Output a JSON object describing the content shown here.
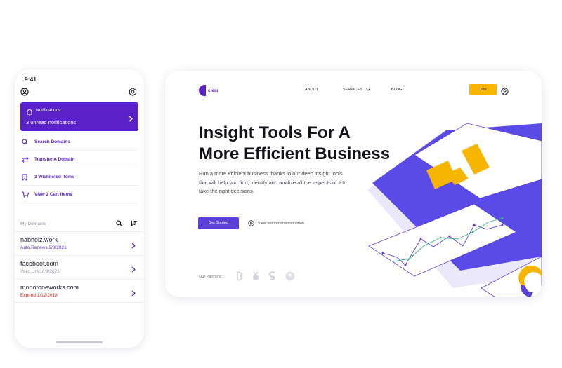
{
  "phone": {
    "time": "9:41",
    "notification": {
      "title": "Notifications",
      "subtitle": "3 unread notifications"
    },
    "quick_links": [
      {
        "label": "Search Domains",
        "icon": "search-icon"
      },
      {
        "label": "Transfer A Domain",
        "icon": "transfer-icon"
      },
      {
        "label": "3 Wishlisted Items",
        "icon": "bookmark-icon"
      },
      {
        "label": "View 2 Cart Items",
        "icon": "cart-icon"
      }
    ],
    "my_domains_label": "My Domains",
    "domains": [
      {
        "name": "nabholz.work",
        "status": "Auto Renews 2/8/2021",
        "status_color": "#5b21c9"
      },
      {
        "name": "faceboot.com",
        "status": "Valid Until 6/9/2021",
        "status_color": "#9a9aa6"
      },
      {
        "name": "monotoneworks.com",
        "status": "Expired 1/12/2019",
        "status_color": "#e0241b"
      }
    ]
  },
  "site": {
    "logo_text": "clear",
    "nav": {
      "about": "ABOUT",
      "services": "SERVICES",
      "blog": "BLOG"
    },
    "join_label": "Join",
    "hero_line1": "Insight Tools For A",
    "hero_line2": "More Efficient Business",
    "description": "Run a more efficient business thanks to our deep insight tools that will help you find, identify and analize all the aspects of it to take the right decisions.",
    "cta_label": "Get Started",
    "video_label": "View our introduction video",
    "partners_label": "Our Partners:"
  },
  "colors": {
    "primary": "#5b21c9",
    "accent": "#f7b500",
    "expired": "#e0241b"
  }
}
